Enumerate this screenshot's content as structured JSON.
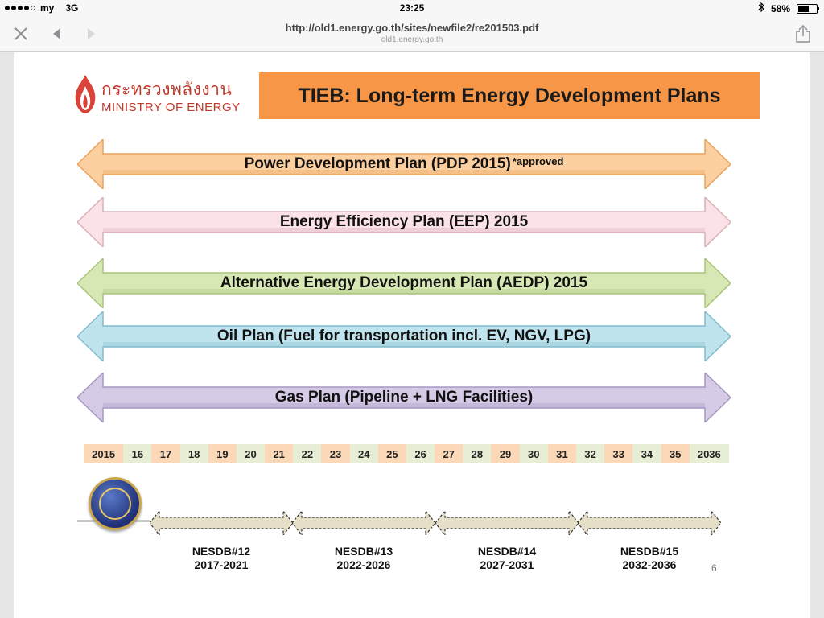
{
  "status": {
    "carrier": "my",
    "network": "3G",
    "time": "23:25",
    "battery": "58%",
    "battery_level": 0.58
  },
  "browser": {
    "url": "http://old1.energy.go.th/sites/newfile2/re201503.pdf",
    "domain": "old1.energy.go.th"
  },
  "slide": {
    "logo_thai": "กระทรวงพลังงาน",
    "logo_en": "MINISTRY OF ENERGY",
    "title": "TIEB: Long-term Energy Development Plans",
    "plans": [
      {
        "label": "Power Development Plan (PDP 2015)",
        "note": "*approved",
        "color": "#fbcf9f",
        "edge": "#e8a35e"
      },
      {
        "label": "Energy Efficiency Plan (EEP) 2015",
        "note": "",
        "color": "#fbe2e6",
        "edge": "#d9b0b8"
      },
      {
        "label": "Alternative Energy Development Plan (AEDP) 2015",
        "note": "",
        "color": "#d8e8b4",
        "edge": "#a9c47a"
      },
      {
        "label": "Oil Plan (Fuel for transportation incl. EV, NGV, LPG)",
        "note": "",
        "color": "#bfe4ee",
        "edge": "#83bccb"
      },
      {
        "label": "Gas Plan (Pipeline + LNG Facilities)",
        "note": "",
        "color": "#d6cbe6",
        "edge": "#a597c0"
      }
    ],
    "years": [
      "2015",
      "16",
      "17",
      "18",
      "19",
      "20",
      "21",
      "22",
      "23",
      "24",
      "25",
      "26",
      "27",
      "28",
      "29",
      "30",
      "31",
      "32",
      "33",
      "34",
      "35",
      "2036"
    ],
    "year_colors": [
      "#fbd8b8",
      "#e6efd6"
    ],
    "nesdb": [
      {
        "name": "NESDB#12",
        "range": "2017-2021"
      },
      {
        "name": "NESDB#13",
        "range": "2022-2026"
      },
      {
        "name": "NESDB#14",
        "range": "2027-2031"
      },
      {
        "name": "NESDB#15",
        "range": "2032-2036"
      }
    ],
    "page_number": "6"
  }
}
